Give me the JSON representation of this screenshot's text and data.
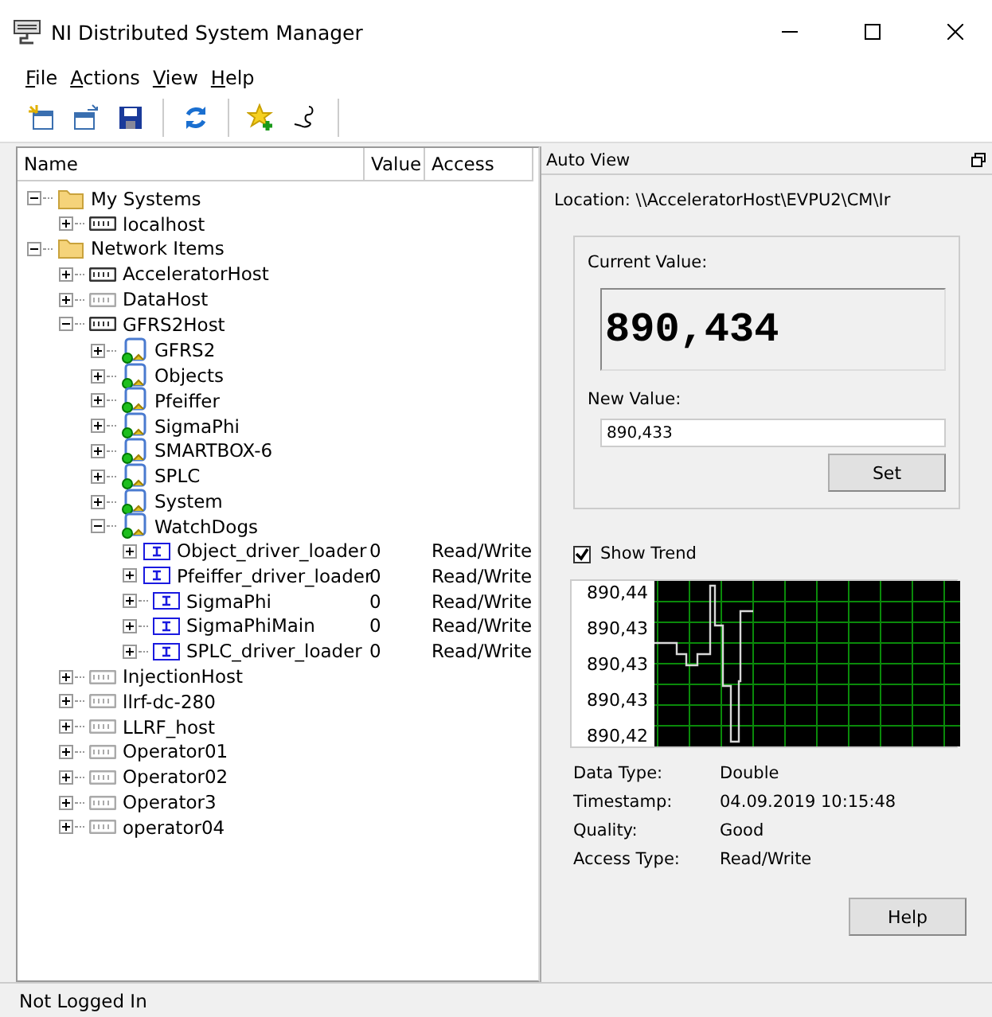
{
  "window": {
    "title": "NI Distributed System Manager"
  },
  "menu": [
    "File",
    "Actions",
    "View",
    "Help"
  ],
  "tree": {
    "columns": [
      "Name",
      "Value",
      "Access"
    ],
    "items": [
      {
        "label": "My Systems",
        "kind": "folder",
        "expanded": true,
        "children": [
          {
            "label": "localhost",
            "kind": "host",
            "active": true,
            "expanded": false
          }
        ]
      },
      {
        "label": "Network Items",
        "kind": "folder",
        "expanded": true,
        "children": [
          {
            "label": "AcceleratorHost",
            "kind": "host",
            "active": true,
            "expanded": false
          },
          {
            "label": "DataHost",
            "kind": "host",
            "active": false,
            "expanded": false
          },
          {
            "label": "GFRS2Host",
            "kind": "host",
            "active": true,
            "expanded": true,
            "children": [
              {
                "label": "GFRS2",
                "kind": "process",
                "expanded": false
              },
              {
                "label": "Objects",
                "kind": "process",
                "expanded": false
              },
              {
                "label": "Pfeiffer",
                "kind": "process",
                "expanded": false
              },
              {
                "label": "SigmaPhi",
                "kind": "process",
                "expanded": false
              },
              {
                "label": "SMARTBOX-6",
                "kind": "process",
                "expanded": false
              },
              {
                "label": "SPLC",
                "kind": "process",
                "expanded": false
              },
              {
                "label": "System",
                "kind": "process",
                "expanded": false
              },
              {
                "label": "WatchDogs",
                "kind": "process",
                "expanded": true,
                "children": [
                  {
                    "label": "Object_driver_loader",
                    "kind": "variable",
                    "expanded": false,
                    "value": "0",
                    "access": "Read/Write"
                  },
                  {
                    "label": "Pfeiffer_driver_loader",
                    "kind": "variable",
                    "expanded": false,
                    "value": "0",
                    "access": "Read/Write"
                  },
                  {
                    "label": "SigmaPhi",
                    "kind": "variable",
                    "expanded": false,
                    "value": "0",
                    "access": "Read/Write"
                  },
                  {
                    "label": "SigmaPhiMain",
                    "kind": "variable",
                    "expanded": false,
                    "value": "0",
                    "access": "Read/Write"
                  },
                  {
                    "label": "SPLC_driver_loader",
                    "kind": "variable",
                    "expanded": false,
                    "value": "0",
                    "access": "Read/Write"
                  }
                ]
              }
            ]
          },
          {
            "label": "InjectionHost",
            "kind": "host",
            "active": false,
            "expanded": false
          },
          {
            "label": "llrf-dc-280",
            "kind": "host",
            "active": false,
            "expanded": false
          },
          {
            "label": "LLRF_host",
            "kind": "host",
            "active": false,
            "expanded": false
          },
          {
            "label": "Operator01",
            "kind": "host",
            "active": false,
            "expanded": false
          },
          {
            "label": "Operator02",
            "kind": "host",
            "active": false,
            "expanded": false
          },
          {
            "label": "Operator3",
            "kind": "host",
            "active": false,
            "expanded": false
          },
          {
            "label": "operator04",
            "kind": "host",
            "active": false,
            "expanded": false
          }
        ]
      }
    ]
  },
  "auto_view": {
    "title": "Auto View",
    "location": "Location: \\\\AcceleratorHost\\EVPU2\\CM\\Ir",
    "current_value_label": "Current Value:",
    "current_value": "890,434",
    "new_value_label": "New Value:",
    "new_value": "890,433",
    "set_button": "Set",
    "show_trend": {
      "label": "Show Trend",
      "checked": true
    },
    "trend_axis_labels": [
      "890,44",
      "890,43",
      "890,43",
      "890,43",
      "890,42"
    ],
    "properties": [
      {
        "label": "Data Type:",
        "value": "Double"
      },
      {
        "label": "Timestamp:",
        "value": "04.09.2019 10:15:48"
      },
      {
        "label": "Quality:",
        "value": "Good"
      },
      {
        "label": "Access Type:",
        "value": "Read/Write"
      }
    ],
    "help_button": "Help"
  },
  "status_bar": "Not Logged In"
}
